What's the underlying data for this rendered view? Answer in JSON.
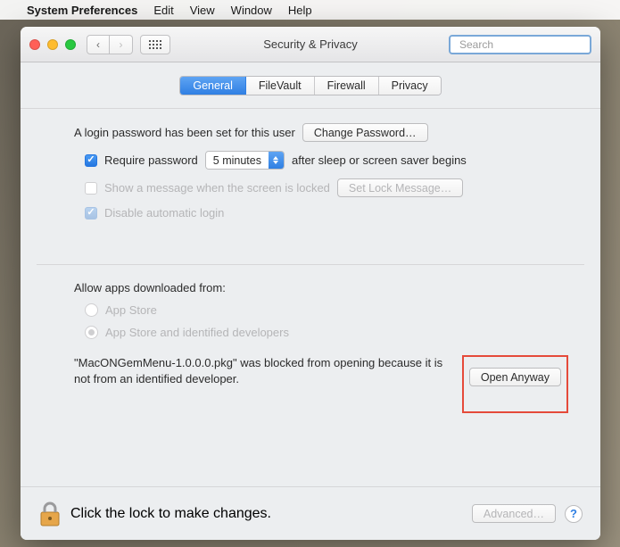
{
  "menubar": {
    "app_name": "System Preferences",
    "items": [
      "Edit",
      "View",
      "Window",
      "Help"
    ]
  },
  "window": {
    "title": "Security & Privacy",
    "search_placeholder": "Search"
  },
  "tabs": [
    "General",
    "FileVault",
    "Firewall",
    "Privacy"
  ],
  "active_tab": "General",
  "general": {
    "login_password_text": "A login password has been set for this user",
    "change_password_label": "Change Password…",
    "require_password_label": "Require password",
    "require_password_delay": "5 minutes",
    "after_sleep_text": "after sleep or screen saver begins",
    "show_message_label": "Show a message when the screen is locked",
    "set_lock_message_label": "Set Lock Message…",
    "disable_auto_login_label": "Disable automatic login",
    "allow_apps_heading": "Allow apps downloaded from:",
    "radio_appstore": "App Store",
    "radio_identified": "App Store and identified developers",
    "blocked_message": "\"MacONGemMenu-1.0.0.0.pkg\" was blocked from opening because it is not from an identified developer.",
    "open_anyway_label": "Open Anyway"
  },
  "footer": {
    "lock_text": "Click the lock to make changes.",
    "advanced_label": "Advanced…"
  }
}
